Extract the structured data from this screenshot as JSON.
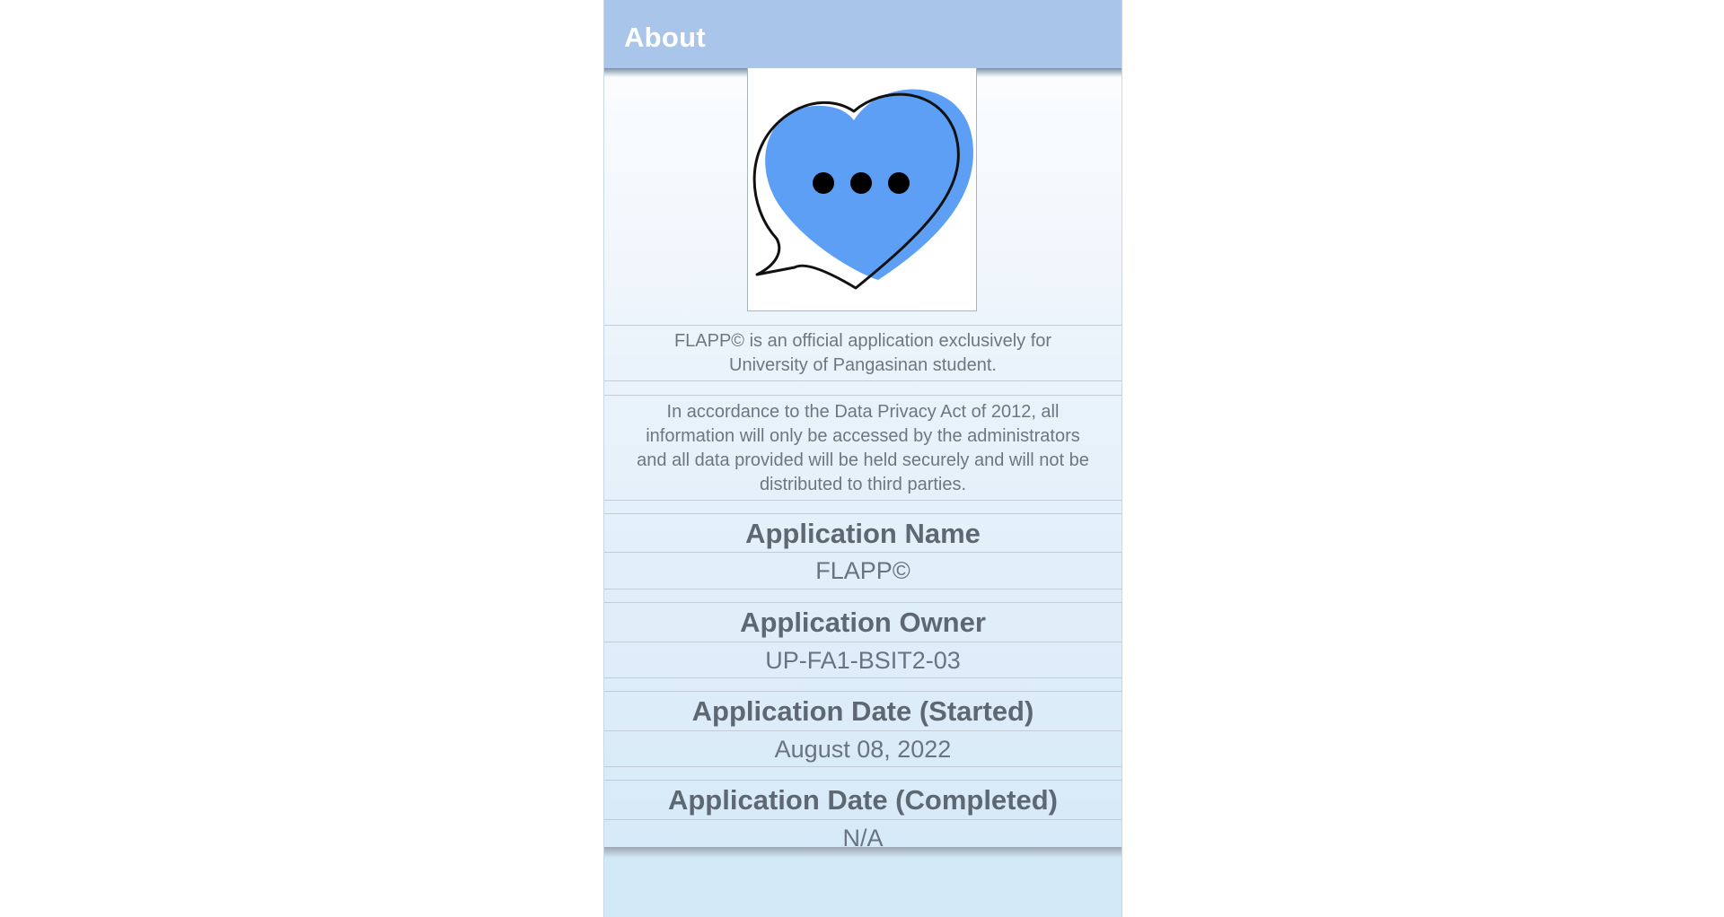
{
  "appbar": {
    "title": "About"
  },
  "logo": {
    "icon": "heart-chat-bubble-logo",
    "accent_color": "#5c9ff5"
  },
  "intro": {
    "line1": "FLAPP© is an official application exclusively for",
    "line2": "University of Pangasinan student."
  },
  "privacy": {
    "line1": "In accordance to the Data Privacy Act of 2012, all",
    "line2": "information will only be accessed by the administrators",
    "line3": "and all data provided will be held securely and will not be",
    "line4": "distributed to third parties."
  },
  "info": {
    "name_label": "Application Name",
    "name_value": "FLAPP©",
    "owner_label": "Application Owner",
    "owner_value": "UP-FA1-BSIT2-03",
    "started_label": "Application Date (Started)",
    "started_value": "August 08, 2022",
    "completed_label": "Application Date (Completed)",
    "completed_value": "N/A"
  }
}
